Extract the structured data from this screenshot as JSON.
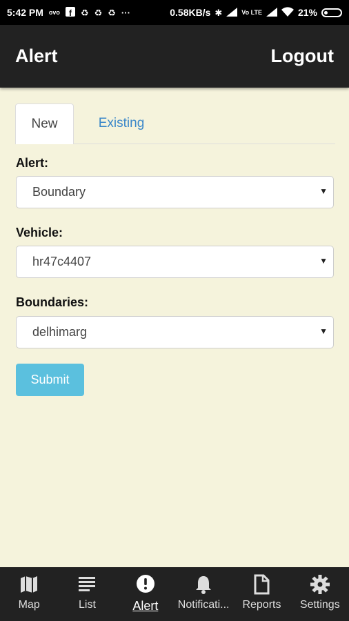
{
  "status_bar": {
    "time": "5:42 PM",
    "net_speed": "0.58KB/s",
    "battery": "21%",
    "icons": [
      "ovo-icon",
      "facebook-icon",
      "sync-icon",
      "sync-icon",
      "sync-icon",
      "more-icon",
      "bluetooth-icon",
      "signal-icon",
      "volte-icon",
      "signal-icon",
      "wifi-icon",
      "battery-icon"
    ],
    "ovo_text": "ovo",
    "volte_text": "Vo LTE"
  },
  "header": {
    "title": "Alert",
    "logout_label": "Logout"
  },
  "tabs": [
    {
      "label": "New"
    },
    {
      "label": "Existing"
    }
  ],
  "form": {
    "alert_label": "Alert:",
    "alert_value": "Boundary",
    "vehicle_label": "Vehicle:",
    "vehicle_value": "hr47c4407",
    "boundaries_label": "Boundaries:",
    "boundaries_value": "delhimarg",
    "submit_label": "Submit"
  },
  "bottom_nav": [
    {
      "label": "Map",
      "icon": "map-icon"
    },
    {
      "label": "List",
      "icon": "list-icon"
    },
    {
      "label": "Alert",
      "icon": "alert-icon",
      "active": true
    },
    {
      "label": "Notificati...",
      "icon": "bell-icon"
    },
    {
      "label": "Reports",
      "icon": "document-icon"
    },
    {
      "label": "Settings",
      "icon": "gear-icon"
    }
  ],
  "colors": {
    "background": "#f5f3dc",
    "appbar": "#222222",
    "accent": "#3a87c9",
    "submit": "#5bc0de"
  }
}
